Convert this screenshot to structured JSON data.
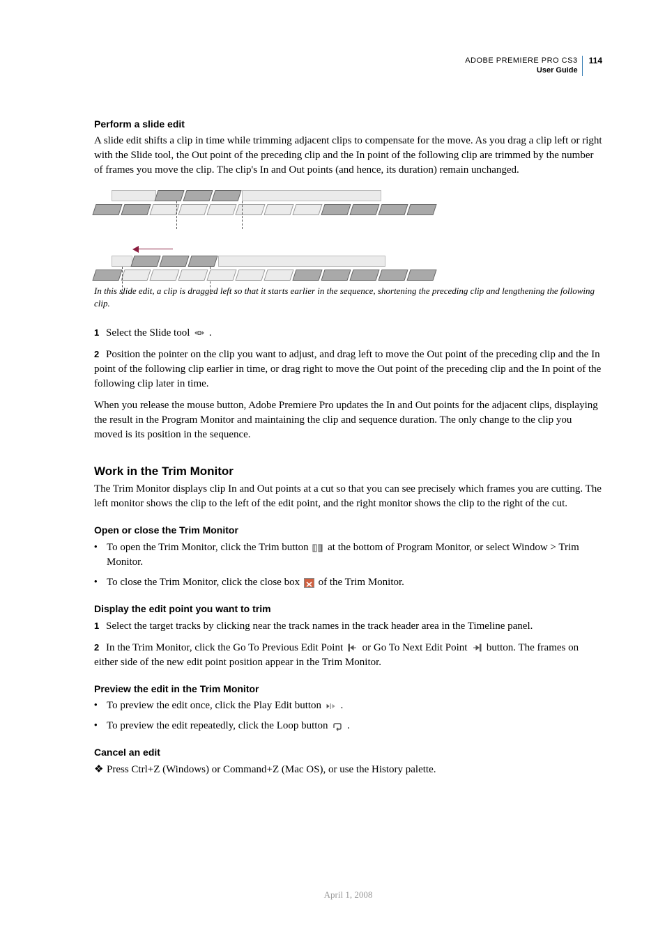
{
  "header": {
    "product": "ADOBE PREMIERE PRO CS3",
    "guide": "User Guide",
    "page": "114"
  },
  "s1": {
    "title": "Perform a slide edit",
    "p1": "A slide edit shifts a clip in time while trimming adjacent clips to compensate for the move. As you drag a clip left or right with the Slide tool, the Out point of the preceding clip and the In point of the following clip are trimmed by the number of frames you move the clip. The clip's In and Out points (and hence, its duration) remain unchanged.",
    "caption": "In this slide edit, a clip is dragged left so that it starts earlier in the sequence, shortening the preceding clip and lengthening the following clip.",
    "step1": "Select the Slide tool",
    "step1_tail": ".",
    "step2": "Position the pointer on the clip you want to adjust, and drag left to move the Out point of the preceding clip and the In point of the following clip earlier in time, or drag right to move the Out point of the preceding clip and the In point of the following clip later in time.",
    "p_release": "When you release the mouse button, Adobe Premiere Pro updates the In and Out points for the adjacent clips, displaying the result in the Program Monitor and maintaining the clip and sequence duration. The only change to the clip you moved is its position in the sequence."
  },
  "s2": {
    "title": "Work in the Trim Monitor",
    "intro": "The Trim Monitor displays clip In and Out points at a cut so that you can see precisely which frames you are cutting. The left monitor shows the clip to the left of the edit point, and the right monitor shows the clip to the right of the cut."
  },
  "s3": {
    "title": "Open or close the Trim Monitor",
    "b1a": "To open the Trim Monitor, click the Trim button",
    "b1b": "at the bottom of Program Monitor, or select Window > Trim Monitor.",
    "b2a": "To close the Trim Monitor, click the close box",
    "b2b": "of the Trim Monitor."
  },
  "s4": {
    "title": "Display the edit point you want to trim",
    "step1": "Select the target tracks by clicking near the track names in the track header area in the Timeline panel.",
    "step2a": "In the Trim Monitor, click the Go To Previous Edit Point",
    "step2b": "or Go To Next Edit Point",
    "step2c": "button. The frames on either side of the new edit point position appear in the Trim Monitor."
  },
  "s5": {
    "title": "Preview the edit in the Trim Monitor",
    "b1": "To preview the edit once, click the Play Edit button",
    "b1_tail": ".",
    "b2": "To preview the edit repeatedly, click the Loop button",
    "b2_tail": "."
  },
  "s6": {
    "title": "Cancel an edit",
    "d1": "Press Ctrl+Z (Windows) or Command+Z (Mac OS), or use the History palette."
  },
  "footer": {
    "date": "April 1, 2008"
  },
  "numbers": {
    "n1": "1",
    "n2": "2"
  }
}
